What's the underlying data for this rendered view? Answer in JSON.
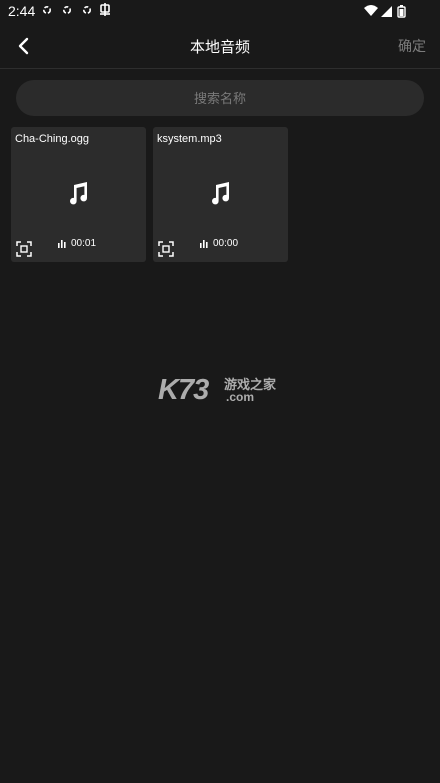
{
  "status_bar": {
    "time": "2:44",
    "notification_icons": [
      "sync-icon",
      "sync-icon",
      "sync-icon",
      "bug-icon"
    ],
    "right_icons": [
      "wifi-icon",
      "signal-icon",
      "battery-icon"
    ]
  },
  "header": {
    "title": "本地音频",
    "confirm_label": "确定"
  },
  "search": {
    "placeholder": "搜索名称"
  },
  "audio_files": [
    {
      "name": "Cha-Ching.ogg",
      "duration": "00:01"
    },
    {
      "name": "ksystem.mp3",
      "duration": "00:00"
    }
  ],
  "watermark": {
    "brand": "K73",
    "cn_text": "游戏之家",
    "domain": ".com"
  },
  "colors": {
    "background": "#191919",
    "card": "#2c2c2c",
    "search_bg": "#2b2b2b",
    "muted_text": "#7c7c7c"
  }
}
